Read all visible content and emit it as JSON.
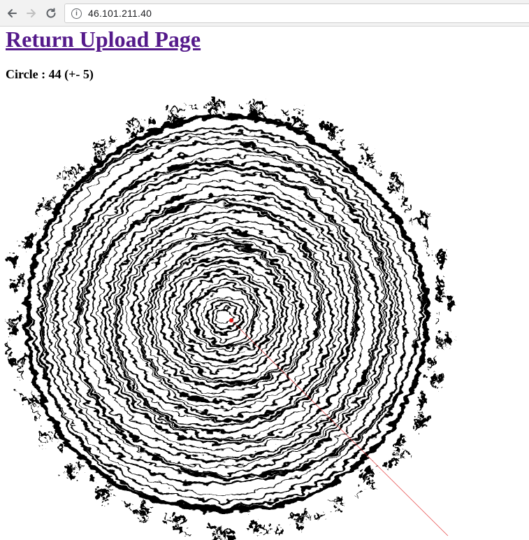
{
  "browser": {
    "url": "46.101.211.40",
    "back_icon": "arrow-left-icon",
    "forward_icon": "arrow-right-icon",
    "reload_icon": "reload-icon",
    "info_icon": "info-icon"
  },
  "page": {
    "return_link_label": "Return Upload Page",
    "circle_result": "Circle : 44 (+- 5)",
    "link_color": "#551a8b",
    "marker_color": "#e01b1b"
  }
}
